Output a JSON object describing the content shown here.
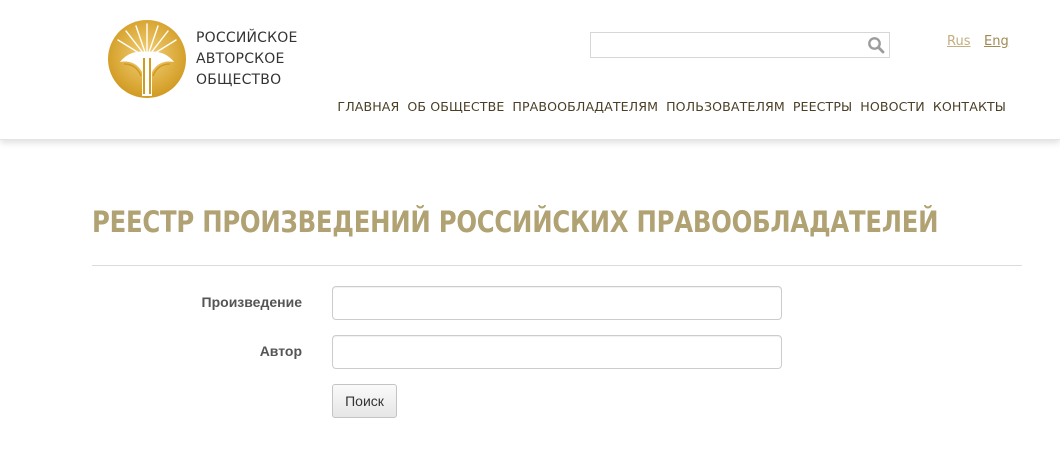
{
  "header": {
    "logo": {
      "icon": "rao-emblem-icon",
      "line1": "РОССИЙСКОЕ",
      "line2": "АВТОРСКОЕ",
      "line3": "ОБЩЕСТВО"
    },
    "search": {
      "placeholder": "",
      "value": "",
      "icon": "search-icon"
    },
    "languages": [
      {
        "label": "Rus"
      },
      {
        "label": "Eng"
      }
    ],
    "nav": [
      {
        "label": "ГЛАВНАЯ"
      },
      {
        "label": "ОБ ОБЩЕСТВЕ"
      },
      {
        "label": "ПРАВООБЛАДАТЕЛЯМ"
      },
      {
        "label": "ПОЛЬЗОВАТЕЛЯМ"
      },
      {
        "label": "РЕЕСТРЫ"
      },
      {
        "label": "НОВОСТИ"
      },
      {
        "label": "КОНТАКТЫ"
      }
    ]
  },
  "main": {
    "title": "РЕЕСТР ПРОИЗВЕДЕНИЙ РОССИЙСКИХ ПРАВООБЛАДАТЕЛЕЙ",
    "form": {
      "work_label": "Произведение",
      "work_value": "",
      "author_label": "Автор",
      "author_value": "",
      "submit_label": "Поиск"
    }
  },
  "colors": {
    "accent_gold": "#b0a272",
    "emblem_gold": "#d9a92c",
    "nav_text": "#4a3f26"
  }
}
